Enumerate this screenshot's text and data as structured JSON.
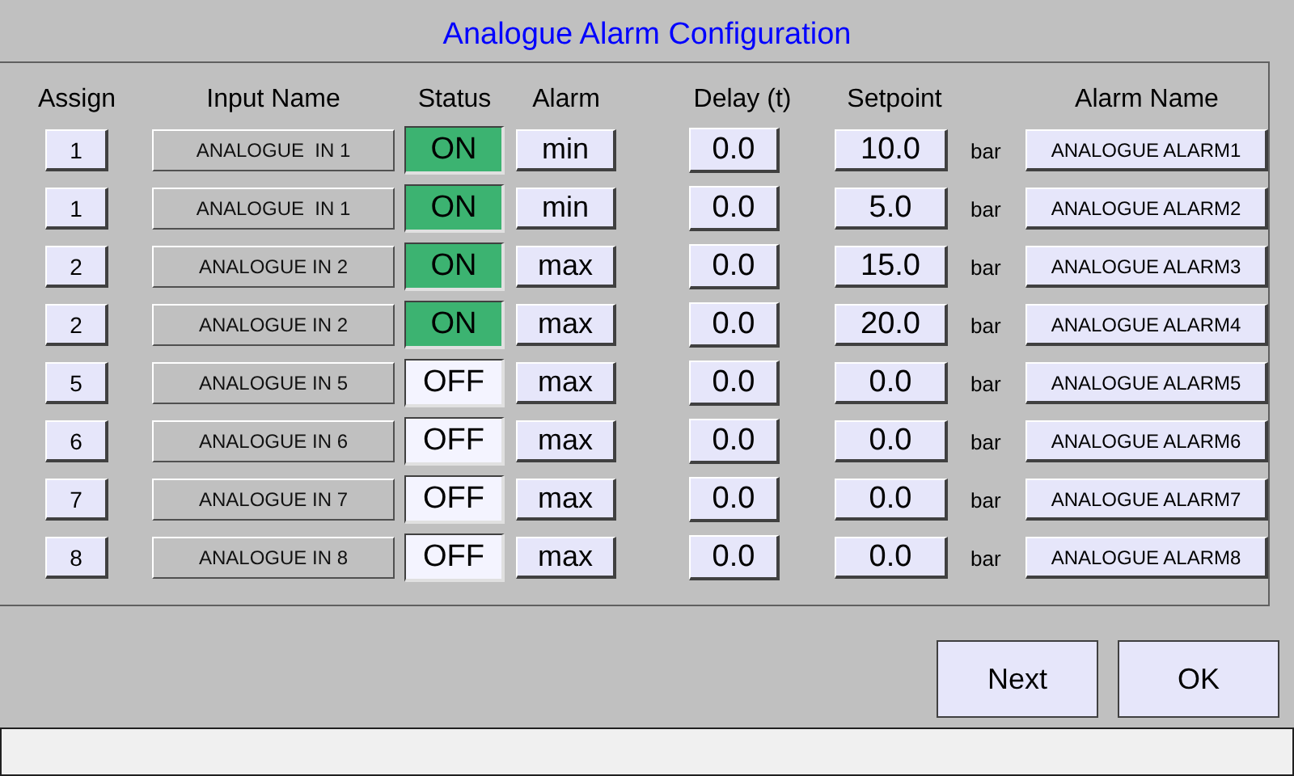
{
  "title": "Analogue Alarm Configuration",
  "columns": [
    "Assign",
    "Input Name",
    "Status",
    "Alarm",
    "Delay (t)",
    "Setpoint",
    "Alarm Name"
  ],
  "rows": [
    {
      "assign": "1",
      "input_name": "ANALOGUE  IN 1",
      "status": {
        "text": "ON",
        "on": true
      },
      "alarm": "min",
      "delay": "0.0",
      "setpoint": "10.0",
      "unit": "bar",
      "alarm_name": "ANALOGUE ALARM1"
    },
    {
      "assign": "1",
      "input_name": "ANALOGUE  IN 1",
      "status": {
        "text": "ON",
        "on": true
      },
      "alarm": "min",
      "delay": "0.0",
      "setpoint": "5.0",
      "unit": "bar",
      "alarm_name": "ANALOGUE ALARM2"
    },
    {
      "assign": "2",
      "input_name": "ANALOGUE IN 2",
      "status": {
        "text": "ON",
        "on": true
      },
      "alarm": "max",
      "delay": "0.0",
      "setpoint": "15.0",
      "unit": "bar",
      "alarm_name": "ANALOGUE ALARM3"
    },
    {
      "assign": "2",
      "input_name": "ANALOGUE IN 2",
      "status": {
        "text": "ON",
        "on": true
      },
      "alarm": "max",
      "delay": "0.0",
      "setpoint": "20.0",
      "unit": "bar",
      "alarm_name": "ANALOGUE ALARM4"
    },
    {
      "assign": "5",
      "input_name": "ANALOGUE IN 5",
      "status": {
        "text": "OFF",
        "on": false
      },
      "alarm": "max",
      "delay": "0.0",
      "setpoint": "0.0",
      "unit": "bar",
      "alarm_name": "ANALOGUE ALARM5"
    },
    {
      "assign": "6",
      "input_name": "ANALOGUE IN 6",
      "status": {
        "text": "OFF",
        "on": false
      },
      "alarm": "max",
      "delay": "0.0",
      "setpoint": "0.0",
      "unit": "bar",
      "alarm_name": "ANALOGUE ALARM6"
    },
    {
      "assign": "7",
      "input_name": "ANALOGUE IN 7",
      "status": {
        "text": "OFF",
        "on": false
      },
      "alarm": "max",
      "delay": "0.0",
      "setpoint": "0.0",
      "unit": "bar",
      "alarm_name": "ANALOGUE ALARM7"
    },
    {
      "assign": "8",
      "input_name": "ANALOGUE IN 8",
      "status": {
        "text": "OFF",
        "on": false
      },
      "alarm": "max",
      "delay": "0.0",
      "setpoint": "0.0",
      "unit": "bar",
      "alarm_name": "ANALOGUE ALARM8"
    }
  ],
  "buttons": [
    "Next",
    "OK"
  ]
}
